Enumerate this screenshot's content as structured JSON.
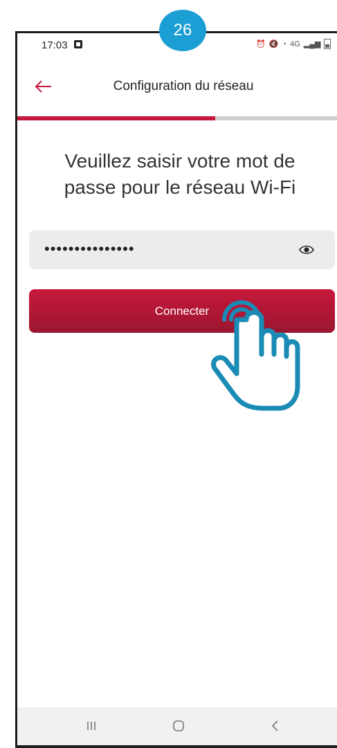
{
  "step_badge": "26",
  "status_bar": {
    "time": "17:03",
    "network": "4G"
  },
  "app_bar": {
    "title": "Configuration du réseau",
    "back_icon": "arrow-left-icon"
  },
  "progress": {
    "fraction": 0.62,
    "fill_color": "#c4183c",
    "track_color": "#cfcfcf"
  },
  "prompt": {
    "line1": "Veuillez saisir votre mot de",
    "line2": "passe pour le réseau Wi-Fi"
  },
  "password_field": {
    "value": "•••••••••••••••",
    "toggle_icon": "eye-icon"
  },
  "connect_button": {
    "label": "Connecter",
    "color": "#c8183b"
  },
  "hand_icon": "tap-hand-icon",
  "nav_bar": {
    "recent_icon": "recent-apps-icon",
    "home_icon": "home-icon",
    "back_icon": "back-icon"
  },
  "colors": {
    "accent": "#c4183c",
    "badge": "#1a9ed4"
  }
}
